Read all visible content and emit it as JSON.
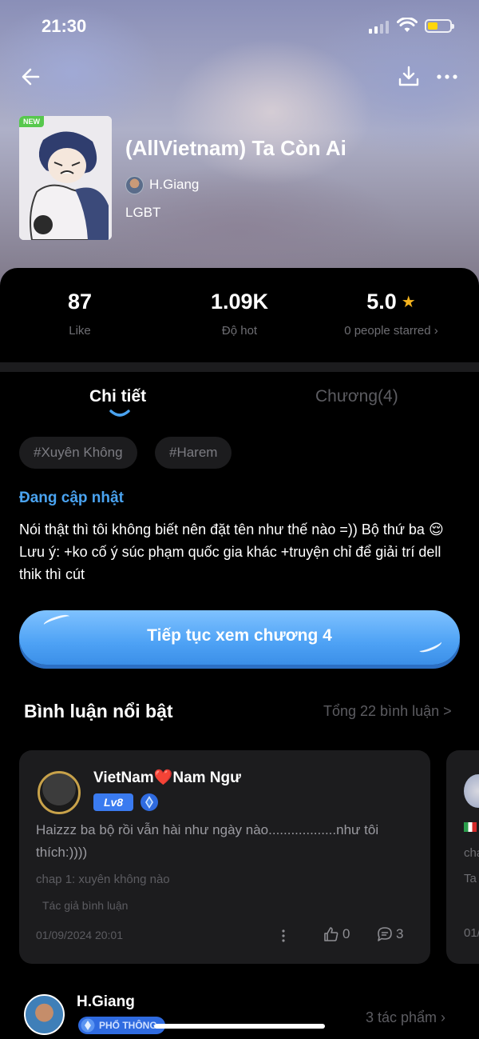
{
  "status_bar": {
    "time": "21:30"
  },
  "header": {
    "new_badge": "NEW"
  },
  "story": {
    "title": "(AllVietnam) Ta Còn Ai",
    "author": "H.Giang",
    "genre": "LGBT"
  },
  "stats": [
    {
      "value": "87",
      "label": "Like"
    },
    {
      "value": "1.09K",
      "label": "Độ hot"
    },
    {
      "value": "5.0",
      "label": "0 people starred ›"
    }
  ],
  "tabs": {
    "detail": "Chi tiết",
    "chapters": "Chương(4)"
  },
  "tags": [
    "#Xuyên Không",
    "#Harem"
  ],
  "update_status": "Đang cập nhật",
  "description": "Nói thật thì tôi không biết nên đặt tên như thế nào =)) Bộ thứ ba 😌 Lưu ý:  +ko cố ý súc phạm quốc gia khác +truyện chỉ để giải trí dell thik thì cút",
  "cta_label": "Tiếp tục xem chương 4",
  "comments_section": {
    "title": "Bình luận nổi bật",
    "total": "Tổng 22 bình luận >"
  },
  "comment": {
    "user": "VietNam❤️Nam Ngư",
    "level": "Lv8",
    "text": "Haizzz ba bộ rồi vẫn hài như ngày nào..................như tôi thích:))))",
    "chapter": "chap 1: xuyên không nào",
    "author_tag": "Tác giả bình luận",
    "date": "01/09/2024 20:01",
    "likes": "0",
    "replies": "3"
  },
  "peek_card": {
    "line1": "cha",
    "line2": "Ta",
    "line3": "01/"
  },
  "author_row": {
    "name": "H.Giang",
    "badge": "PHỔ THÔNG",
    "works": "3 tác phẩm  ›"
  },
  "colors": {
    "accent_blue": "#4aa3f0",
    "star": "#f5b41e",
    "battery": "#ffd60a"
  }
}
